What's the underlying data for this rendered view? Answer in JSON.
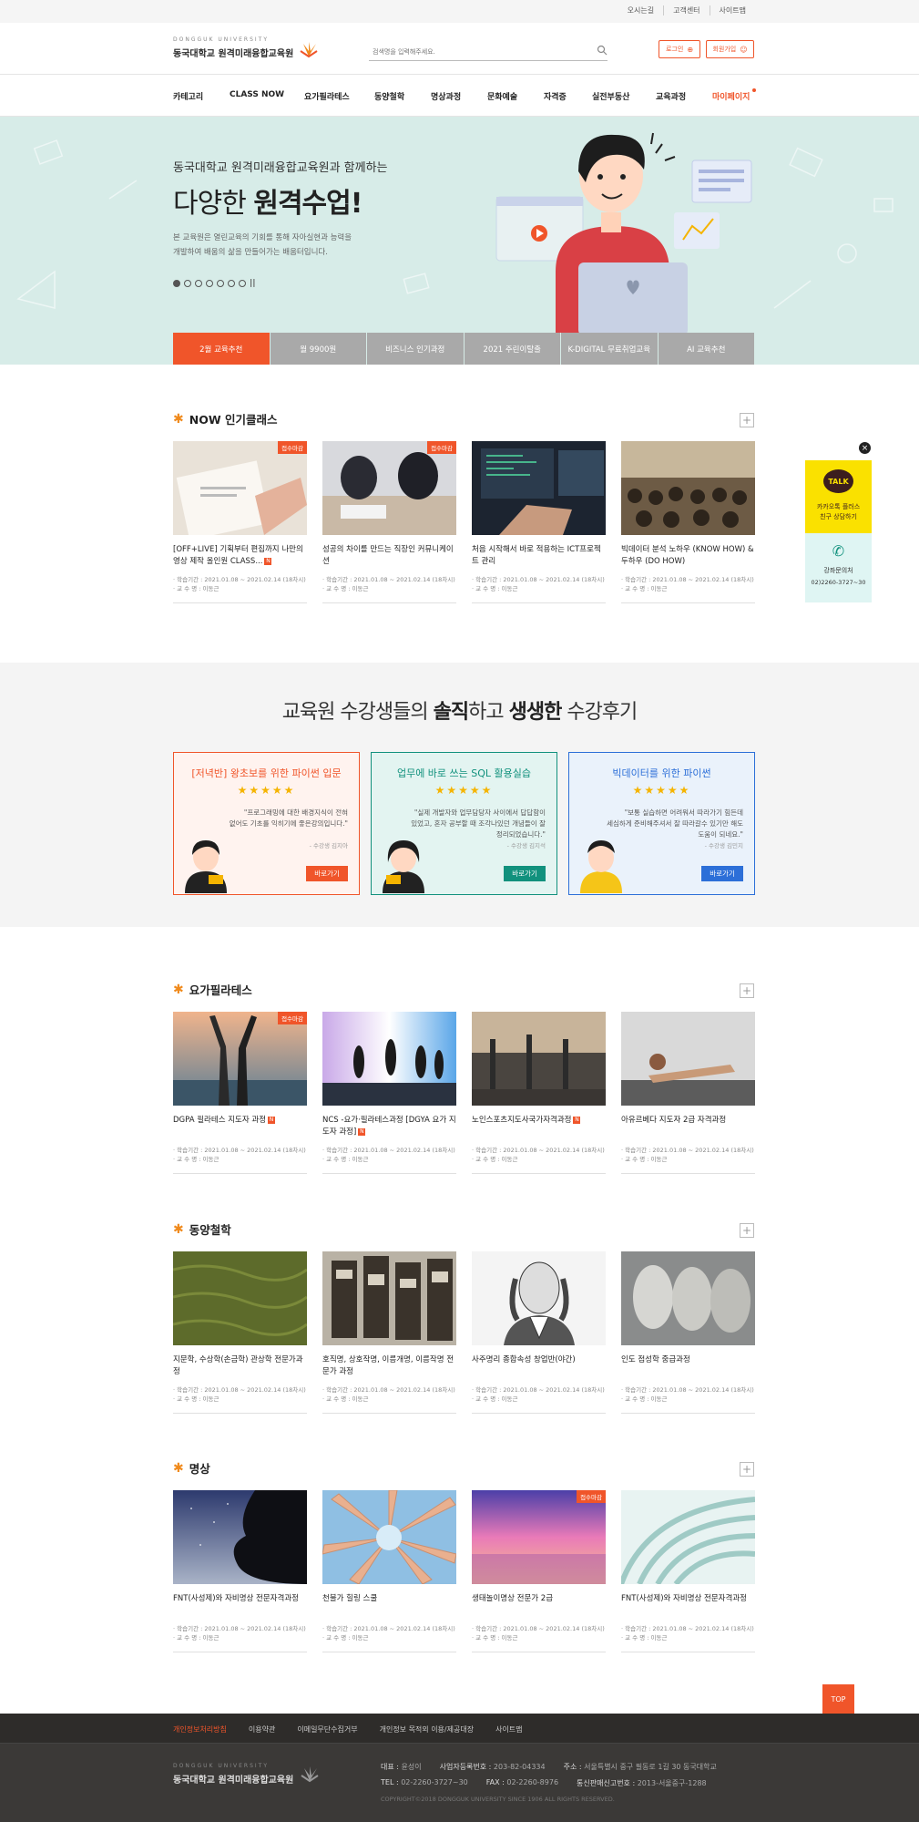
{
  "util_links": [
    "오시는길",
    "고객센터",
    "사이트맵"
  ],
  "logo": {
    "sub": "DONGGUK UNIVERSITY",
    "main": "동국대학교 원격미래융합교육원"
  },
  "search": {
    "placeholder": "검색명을 입력해주세요."
  },
  "header_buttons": {
    "login": "로그인",
    "join": "회원가입"
  },
  "nav": [
    "카테고리",
    "CLASS NOW",
    "요가필라테스",
    "동양철학",
    "명상과정",
    "문화예술",
    "자격증",
    "실전부동산",
    "교육과정",
    "마이페이지"
  ],
  "hero": {
    "subtitle": "동국대학교 원격미래융합교육원과 함께하는",
    "title_light": "다양한",
    "title_bold": "원격수업!",
    "desc_line1": "본 교육원은 열린교육의 기회를 통해 자아실현과 능력을",
    "desc_line2": "개발하여 배움의 삶을 만들어가는 배움터입니다.",
    "tabs": [
      "2월 교육추천",
      "월 9900원",
      "비즈니스 인기과정",
      "2021 주린이탈출",
      "K-DIGITAL 무료취업교육",
      "AI 교육추천"
    ]
  },
  "sections": {
    "now": {
      "title": "NOW 인기클래스",
      "cards": [
        {
          "badge": "접수마감",
          "title": "[OFF+LIVE] 기획부터 편집까지 나만의 영상 제작 올인원 CLASS...",
          "new": "N",
          "period": "· 학습기간 : 2021.01.08 ~ 2021.02.14 (18차시)",
          "teacher": "· 교 수 명 : 이동근"
        },
        {
          "badge": "접수마감",
          "title": "성공의 차이를 만드는 직장인 커뮤니케이션",
          "new": "",
          "period": "· 학습기간 : 2021.01.08 ~ 2021.02.14 (18차시)",
          "teacher": "· 교 수 명 : 이동근"
        },
        {
          "badge": "",
          "title": "처음 시작해서 바로 적용하는 ICT프로젝트 관리",
          "new": "",
          "period": "· 학습기간 : 2021.01.08 ~ 2021.02.14 (18차시)",
          "teacher": "· 교 수 명 : 이동근"
        },
        {
          "badge": "",
          "title": "빅데이터 분석 노하우 (KNOW HOW) & 두하우 (DO HOW)",
          "new": "",
          "period": "· 학습기간 : 2021.01.08 ~ 2021.02.14 (18차시)",
          "teacher": "· 교 수 명 : 이동근"
        }
      ]
    },
    "yoga": {
      "title": "요가필라테스",
      "cards": [
        {
          "badge": "접수마감",
          "title": "DGPA 필라테스 지도자 과정",
          "new": "N",
          "period": "· 학습기간 : 2021.01.08 ~ 2021.02.14 (18차시)",
          "teacher": "· 교 수 명 : 이동근"
        },
        {
          "badge": "",
          "title": "NCS -요가·필라테스과정 [DGYA 요가 지도자 과정]",
          "new": "N",
          "period": "· 학습기간 : 2021.01.08 ~ 2021.02.14 (18차시)",
          "teacher": "· 교 수 명 : 이동근"
        },
        {
          "badge": "",
          "title": "노인스포츠지도사국가자격과정",
          "new": "N",
          "period": "· 학습기간 : 2021.01.08 ~ 2021.02.14 (18차시)",
          "teacher": "· 교 수 명 : 이동근"
        },
        {
          "badge": "",
          "title": "아유르베다 지도자 2급 자격과정",
          "new": "",
          "period": "· 학습기간 : 2021.01.08 ~ 2021.02.14 (18차시)",
          "teacher": "· 교 수 명 : 이동근"
        }
      ]
    },
    "east": {
      "title": "동양철학",
      "cards": [
        {
          "badge": "",
          "title": "지문학, 수상학(손금학) 관상학 전문가과정",
          "new": "",
          "period": "· 학습기간 : 2021.01.08 ~ 2021.02.14 (18차시)",
          "teacher": "· 교 수 명 : 이동근"
        },
        {
          "badge": "",
          "title": "호직명, 상호작명, 이름개명, 이름작명 전문가 과정",
          "new": "",
          "period": "· 학습기간 : 2021.01.08 ~ 2021.02.14 (18차시)",
          "teacher": "· 교 수 명 : 이동근"
        },
        {
          "badge": "",
          "title": "사주명리 종합속성 창업반(야간)",
          "new": "",
          "period": "· 학습기간 : 2021.01.08 ~ 2021.02.14 (18차시)",
          "teacher": "· 교 수 명 : 이동근"
        },
        {
          "badge": "",
          "title": "인도 점성학 중급과정",
          "new": "",
          "period": "· 학습기간 : 2021.01.08 ~ 2021.02.14 (18차시)",
          "teacher": "· 교 수 명 : 이동근"
        }
      ]
    },
    "med": {
      "title": "명상",
      "cards": [
        {
          "badge": "",
          "title": "FNT(사성제)와 자비명상 전문자격과정",
          "new": "",
          "period": "· 학습기간 : 2021.01.08 ~ 2021.02.14 (18차시)",
          "teacher": "· 교 수 명 : 이동근"
        },
        {
          "badge": "",
          "title": "천불가 힐링 스쿨",
          "new": "",
          "period": "· 학습기간 : 2021.01.08 ~ 2021.02.14 (18차시)",
          "teacher": "· 교 수 명 : 이동근"
        },
        {
          "badge": "접수마감",
          "title": "생태놀이명상 전문가 2급",
          "new": "",
          "period": "· 학습기간 : 2021.01.08 ~ 2021.02.14 (18차시)",
          "teacher": "· 교 수 명 : 이동근"
        },
        {
          "badge": "",
          "title": "FNT(사성제)와 자비명상 전문자격과정",
          "new": "",
          "period": "· 학습기간 : 2021.01.08 ~ 2021.02.14 (18차시)",
          "teacher": "· 교 수 명 : 이동근"
        }
      ]
    }
  },
  "review": {
    "title_a": "교육원 수강생들의",
    "title_b": "솔직",
    "title_c": "하고",
    "title_d": "생생한",
    "title_e": "수강후기",
    "boxes": [
      {
        "title": "[저녁반] 왕초보를 위한 파이썬 입문",
        "stars": "★★★★★",
        "q1": "\"프로그래밍에 대한 배경지식이 전혀",
        "q2": "없어도 기초를 익히기에 좋은강의입니다.\"",
        "who": "- 수강생 김지아",
        "go": "바로가기",
        "color": "#f0552a"
      },
      {
        "title": "업무에 바로 쓰는 SQL 활용실습",
        "stars": "★★★★★",
        "q1": "\"실제 개발자와 업무담당자 사이에서 답답함이",
        "q2": "있었고, 혼자 공부할 때 조각나있던 개념들이 잘 정리되었습니다.\"",
        "who": "- 수강생 김지석",
        "go": "바로가기",
        "color": "#11917d"
      },
      {
        "title": "빅데이터를 위한 파이썬",
        "stars": "★★★★★",
        "q1": "\"보통 실습하면 어려워서 따라가기 힘든데",
        "q2": "세심하게 준비해주셔서 잘 따라갈수 있기만 해도 도움이 되네요.\"",
        "who": "- 수강생 김민지",
        "go": "바로가기",
        "color": "#2c6fd8"
      }
    ]
  },
  "float": {
    "talk": "TALK",
    "kakao1": "카카오톡 플러스",
    "kakao2": "친구 상담하기",
    "call_title": "강좌문의처",
    "call_num": "02)2260-3727~30",
    "close": "×"
  },
  "top_button": "TOP",
  "footer": {
    "links": [
      "개인정보처리방침",
      "이용약관",
      "이메일무단수집거부",
      "개인정보 목적외 이용/제공대장",
      "사이트맵"
    ],
    "logo_sub": "DONGGUK UNIVERSITY",
    "logo_main": "동국대학교 원격미래융합교육원",
    "rep_label": "대표 :",
    "rep": "윤성이",
    "biz_label": "사업자등록번호 :",
    "biz": "203-82-04334",
    "addr_label": "주소 :",
    "addr": "서울특별시 중구 필동로 1길 30 동국대학교",
    "tel_label": "TEL :",
    "tel": "02-2260-3727~30",
    "fax_label": "FAX :",
    "fax": "02-2260-8976",
    "reg_label": "통신판매신고번호 :",
    "reg": "2013-서울중구-1288",
    "copyright": "COPYRIGHT©2018 DONGGUK UNIVERSITY SINCE 1906 ALL RIGHTS RESERVED."
  },
  "colors": {
    "accent": "#f0552a",
    "hero_bg": "#d7ece8",
    "footer_bg": "#3b3937"
  }
}
